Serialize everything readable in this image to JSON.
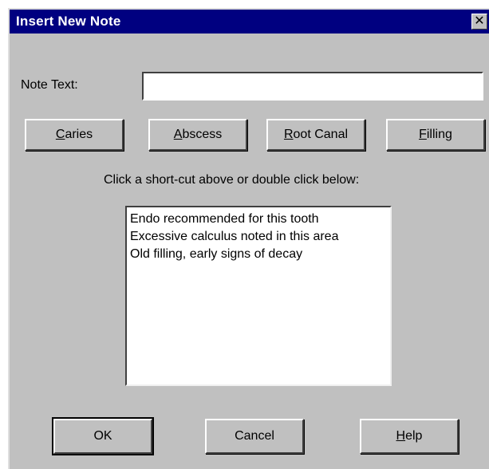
{
  "window": {
    "title": "Insert New Note",
    "close_glyph": "✕"
  },
  "note": {
    "label": "Note Text:",
    "value": ""
  },
  "shortcuts": [
    {
      "mnemonic": "C",
      "rest": "aries"
    },
    {
      "mnemonic": "A",
      "rest": "bscess"
    },
    {
      "mnemonic": "R",
      "rest": "oot Canal"
    },
    {
      "mnemonic": "F",
      "rest": "illing"
    }
  ],
  "instruction": "Click a short-cut above or double click below:",
  "list": {
    "items": [
      "Endo recommended for this tooth",
      "Excessive calculus noted in this area",
      "Old filling, early signs of decay"
    ]
  },
  "footer": {
    "ok": "OK",
    "cancel": "Cancel",
    "help": {
      "mnemonic": "H",
      "rest": "elp"
    }
  }
}
